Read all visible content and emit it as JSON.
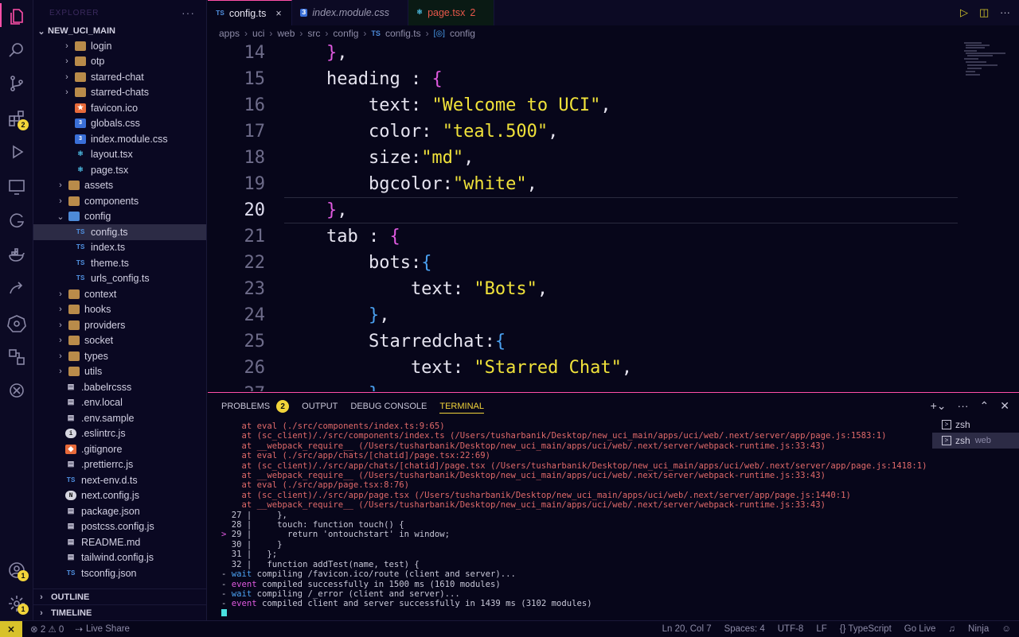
{
  "activity": {
    "badges": {
      "extensions": "2",
      "accounts": "1",
      "settings": "1"
    }
  },
  "sidebar": {
    "title": "EXPLORER",
    "root": "NEW_UCI_MAIN",
    "items": [
      {
        "label": "login",
        "type": "folder",
        "depth": 2,
        "chev": "›"
      },
      {
        "label": "otp",
        "type": "folder",
        "depth": 2,
        "chev": "›"
      },
      {
        "label": "starred-chat",
        "type": "folder",
        "depth": 2,
        "chev": "›"
      },
      {
        "label": "starred-chats",
        "type": "folder",
        "depth": 2,
        "chev": "›"
      },
      {
        "label": "favicon.ico",
        "type": "star",
        "depth": 2
      },
      {
        "label": "globals.css",
        "type": "css",
        "depth": 2
      },
      {
        "label": "index.module.css",
        "type": "css",
        "depth": 2
      },
      {
        "label": "layout.tsx",
        "type": "react",
        "depth": 2
      },
      {
        "label": "page.tsx",
        "type": "react",
        "depth": 2
      },
      {
        "label": "assets",
        "type": "folder",
        "depth": 1,
        "chev": "›"
      },
      {
        "label": "components",
        "type": "folder",
        "depth": 1,
        "chev": "›"
      },
      {
        "label": "config",
        "type": "folder-open",
        "depth": 1,
        "chev": "⌄"
      },
      {
        "label": "config.ts",
        "type": "ts",
        "depth": 2,
        "selected": true
      },
      {
        "label": "index.ts",
        "type": "ts",
        "depth": 2
      },
      {
        "label": "theme.ts",
        "type": "ts",
        "depth": 2
      },
      {
        "label": "urls_config.ts",
        "type": "ts",
        "depth": 2
      },
      {
        "label": "context",
        "type": "folder",
        "depth": 1,
        "chev": "›"
      },
      {
        "label": "hooks",
        "type": "folder",
        "depth": 1,
        "chev": "›"
      },
      {
        "label": "providers",
        "type": "folder",
        "depth": 1,
        "chev": "›"
      },
      {
        "label": "socket",
        "type": "folder",
        "depth": 1,
        "chev": "›"
      },
      {
        "label": "types",
        "type": "folder",
        "depth": 1,
        "chev": "›"
      },
      {
        "label": "utils",
        "type": "folder",
        "depth": 1,
        "chev": "›"
      },
      {
        "label": ".babelrcsss",
        "type": "file",
        "depth": 0
      },
      {
        "label": ".env.local",
        "type": "file",
        "depth": 0
      },
      {
        "label": ".env.sample",
        "type": "file",
        "depth": 0
      },
      {
        "label": ".eslintrc.js",
        "type": "info",
        "depth": 0
      },
      {
        "label": ".gitignore",
        "type": "git",
        "depth": 0
      },
      {
        "label": ".prettierrc.js",
        "type": "file",
        "depth": 0
      },
      {
        "label": "next-env.d.ts",
        "type": "ts",
        "depth": 0
      },
      {
        "label": "next.config.js",
        "type": "next",
        "depth": 0
      },
      {
        "label": "package.json",
        "type": "file",
        "depth": 0
      },
      {
        "label": "postcss.config.js",
        "type": "file",
        "depth": 0
      },
      {
        "label": "README.md",
        "type": "file",
        "depth": 0
      },
      {
        "label": "tailwind.config.js",
        "type": "file",
        "depth": 0
      },
      {
        "label": "tsconfig.json",
        "type": "ts",
        "depth": 0
      }
    ],
    "outline": "OUTLINE",
    "timeline": "TIMELINE"
  },
  "tabs": [
    {
      "icon": "TS",
      "label": "config.ts",
      "active": true,
      "close": "×"
    },
    {
      "icon": "CSS",
      "label": "index.module.css",
      "italic": true
    },
    {
      "icon": "⚛",
      "label": "page.tsx",
      "error": "2"
    }
  ],
  "breadcrumb": [
    "apps",
    "uci",
    "web",
    "src",
    "config",
    "config.ts",
    "config"
  ],
  "editor": {
    "current_line": 20,
    "lines": [
      {
        "n": "14",
        "html": "    <span class='b1'>}</span>,"
      },
      {
        "n": "15",
        "html": "    heading : <span class='b1'>{</span>"
      },
      {
        "n": "16",
        "html": "        text: <span class='str'>\"Welcome to UCI\"</span>,"
      },
      {
        "n": "17",
        "html": "        color: <span class='str'>\"teal.500\"</span>,"
      },
      {
        "n": "18",
        "html": "        size:<span class='str'>\"md\"</span>,"
      },
      {
        "n": "19",
        "html": "        bgcolor:<span class='str'>\"white\"</span>,"
      },
      {
        "n": "20",
        "html": "    <span class='b1'>}</span>,"
      },
      {
        "n": "21",
        "html": "    tab : <span class='b1'>{</span>"
      },
      {
        "n": "22",
        "html": "        bots:<span class='b2'>{</span>"
      },
      {
        "n": "23",
        "html": "            text: <span class='str'>\"Bots\"</span>,"
      },
      {
        "n": "24",
        "html": "        <span class='b2'>}</span>,"
      },
      {
        "n": "25",
        "html": "        Starredchat:<span class='b2'>{</span>"
      },
      {
        "n": "26",
        "html": "            text: <span class='str'>\"Starred Chat\"</span>,"
      },
      {
        "n": "27",
        "html": "        <span class='b2'>}</span>"
      }
    ]
  },
  "panel": {
    "tabs": [
      "PROBLEMS",
      "OUTPUT",
      "DEBUG CONSOLE",
      "TERMINAL"
    ],
    "problems_count": "2",
    "terminals": [
      {
        "name": "zsh",
        "sub": ""
      },
      {
        "name": "zsh",
        "sub": "web"
      }
    ],
    "terminal_lines": [
      "    at eval (./src/components/index.ts:9:65)",
      "    at (sc_client)/./src/components/index.ts (/Users/tusharbanik/Desktop/new_uci_main/apps/uci/web/.next/server/app/page.js:1583:1)",
      "    at __webpack_require__ (/Users/tusharbanik/Desktop/new_uci_main/apps/uci/web/.next/server/webpack-runtime.js:33:43)",
      "    at eval (./src/app/chats/[chatid]/page.tsx:22:69)",
      "    at (sc_client)/./src/app/chats/[chatid]/page.tsx (/Users/tusharbanik/Desktop/new_uci_main/apps/uci/web/.next/server/app/page.js:1418:1)",
      "    at __webpack_require__ (/Users/tusharbanik/Desktop/new_uci_main/apps/uci/web/.next/server/webpack-runtime.js:33:43)",
      "    at eval (./src/app/page.tsx:8:76)",
      "    at (sc_client)/./src/app/page.tsx (/Users/tusharbanik/Desktop/new_uci_main/apps/uci/web/.next/server/app/page.js:1440:1)",
      "    at __webpack_require__ (/Users/tusharbanik/Desktop/new_uci_main/apps/uci/web/.next/server/webpack-runtime.js:33:43)"
    ],
    "code_frame": [
      {
        "mark": "  ",
        "n": "27",
        "text": "    },"
      },
      {
        "mark": "  ",
        "n": "28",
        "text": "    touch: function touch() {"
      },
      {
        "mark": "> ",
        "n": "29",
        "text": "      return 'ontouchstart' in window;"
      },
      {
        "mark": "  ",
        "n": "30",
        "text": "    }"
      },
      {
        "mark": "  ",
        "n": "31",
        "text": "  };"
      },
      {
        "mark": "  ",
        "n": "32",
        "text": "  function addTest(name, test) {"
      }
    ],
    "log_lines": [
      {
        "kind": "wait",
        "text": " compiling /favicon.ico/route (client and server)..."
      },
      {
        "kind": "event",
        "text": " compiled successfully in 1500 ms (1610 modules)"
      },
      {
        "kind": "wait",
        "text": " compiling /_error (client and server)..."
      },
      {
        "kind": "event",
        "text": " compiled client and server successfully in 1439 ms (3102 modules)"
      }
    ]
  },
  "status": {
    "remote": "⨯",
    "errors": "⊗ 2  ⚠ 0",
    "live_share": "Live Share",
    "position": "Ln 20, Col 7",
    "spaces": "Spaces: 4",
    "encoding": "UTF-8",
    "eol": "LF",
    "language": "{} TypeScript",
    "golive": "Go Live",
    "ninja": "Ninja"
  }
}
